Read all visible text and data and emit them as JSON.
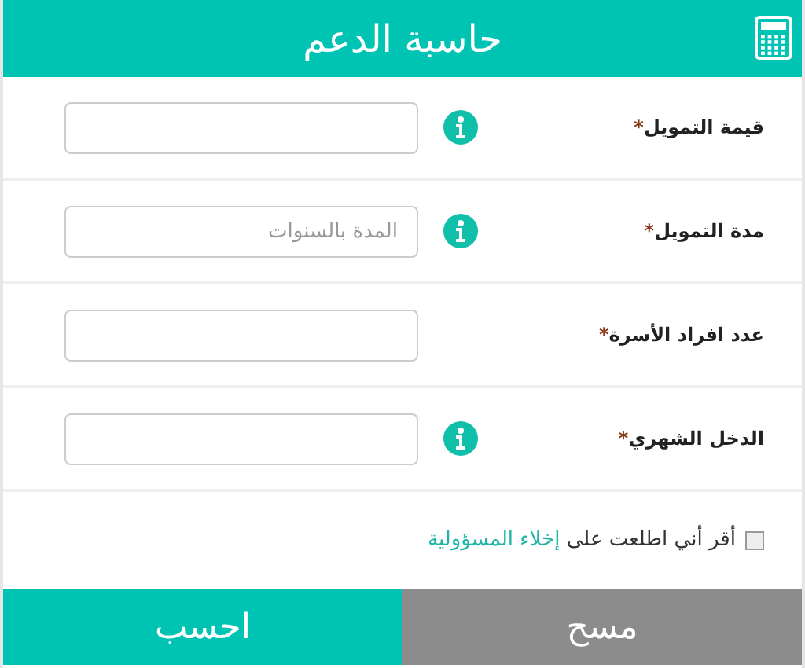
{
  "header": {
    "title": "حاسبة الدعم"
  },
  "fields": [
    {
      "label": "قيمة التمويل",
      "marker": "*",
      "info": true
    },
    {
      "label": "مدة التمويل",
      "marker": "*",
      "info": true,
      "placeholder": "المدة بالسنوات"
    },
    {
      "label": "عدد افراد الأسرة",
      "marker": "*",
      "info": false
    },
    {
      "label": "الدخل الشهري",
      "marker": "*",
      "info": true
    }
  ],
  "agreement": {
    "checked": false,
    "text": "أقر أني اطلعت على",
    "link": "إخلاء المسؤولية"
  },
  "buttons": [
    {
      "label": "مسح",
      "kind": "clear"
    },
    {
      "label": "احسب",
      "kind": "submit"
    }
  ]
}
